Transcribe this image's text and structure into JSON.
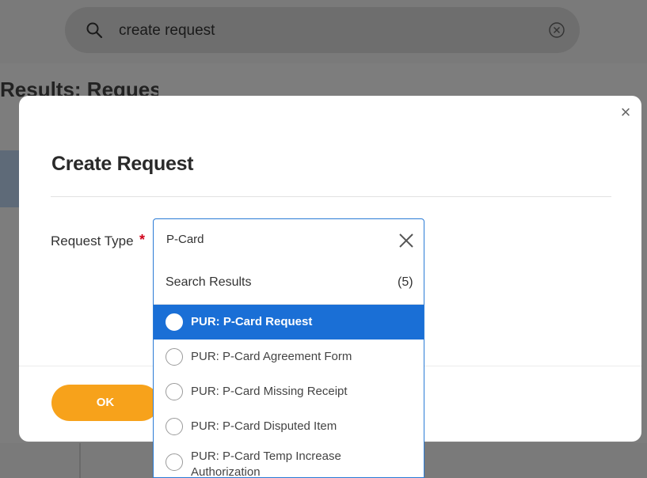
{
  "background": {
    "search": {
      "query": "create request",
      "search_icon": "search-icon",
      "clear_icon": "clear-circle-icon"
    },
    "results_heading": "Results: Request"
  },
  "modal": {
    "title": "Create Request",
    "close_icon": "close-icon",
    "close_label": "×",
    "field": {
      "label": "Request Type",
      "required_marker": "*"
    },
    "ok_label": "OK",
    "ok_color": "#f7a21b"
  },
  "dropdown": {
    "input_value": "P-Card",
    "clear_icon": "close-icon",
    "results_label": "Search Results",
    "results_count": "(5)",
    "accent_color": "#1a6fd6",
    "options": [
      {
        "label": "PUR: P-Card Request",
        "selected": true
      },
      {
        "label": "PUR: P-Card Agreement Form",
        "selected": false
      },
      {
        "label": "PUR: P-Card Missing Receipt",
        "selected": false
      },
      {
        "label": "PUR: P-Card Disputed Item",
        "selected": false
      },
      {
        "label": "PUR: P-Card Temp Increase Authorization",
        "selected": false
      }
    ]
  }
}
